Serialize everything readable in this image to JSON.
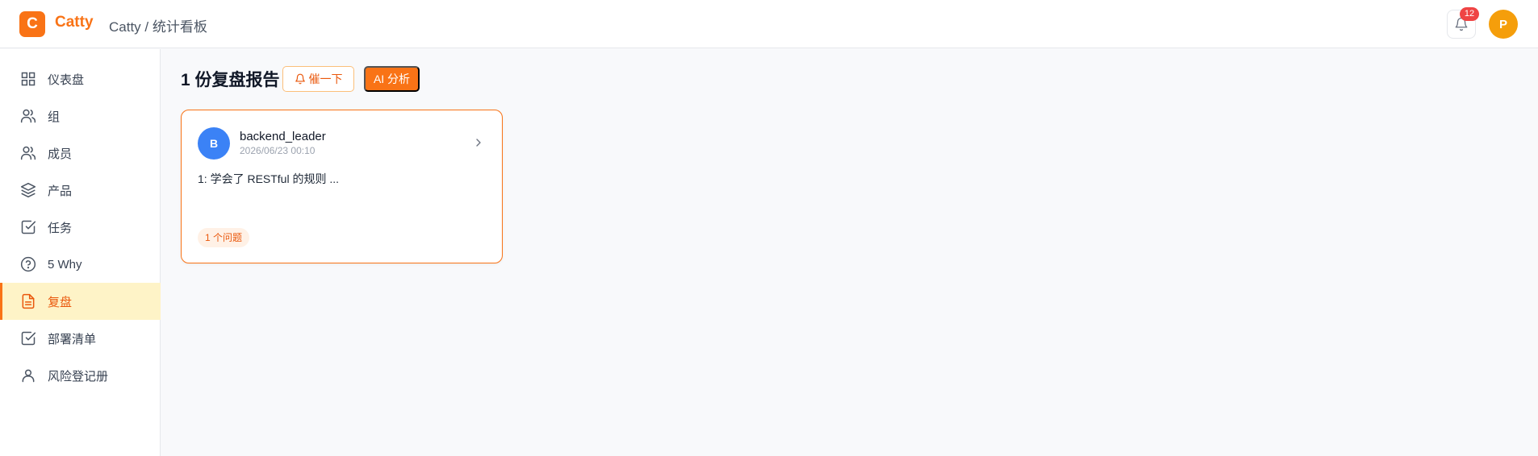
{
  "header": {
    "logo_letter": "C",
    "brand": "Catty",
    "breadcrumb": "Catty / 统计看板",
    "notification_count": "12",
    "user_initial": "P",
    "colors": {
      "accent": "#f97316",
      "badge": "#ef4444",
      "avatar": "#f59e0b"
    }
  },
  "sidebar": {
    "items": [
      {
        "label": "仪表盘",
        "icon": "grid-icon"
      },
      {
        "label": "组",
        "icon": "users-icon"
      },
      {
        "label": "成员",
        "icon": "users-icon"
      },
      {
        "label": "产品",
        "icon": "layers-icon"
      },
      {
        "label": "任务",
        "icon": "check-square-icon"
      },
      {
        "label": "5 Why",
        "icon": "help-circle-icon"
      },
      {
        "label": "复盘",
        "icon": "file-text-icon",
        "active": true
      },
      {
        "label": "部署清单",
        "icon": "check-square-icon"
      },
      {
        "label": "风险登记册",
        "icon": "user-icon"
      }
    ]
  },
  "main": {
    "title": "1 份复盘报告",
    "remind_label": "催一下",
    "ai_label": "AI 分析",
    "cards": [
      {
        "avatar_initial": "B",
        "username": "backend_leader",
        "time": "2026/06/23 00:10",
        "summary": "1:  学会了 RESTful 的规则 ...",
        "tag": "1 个问题"
      }
    ]
  }
}
